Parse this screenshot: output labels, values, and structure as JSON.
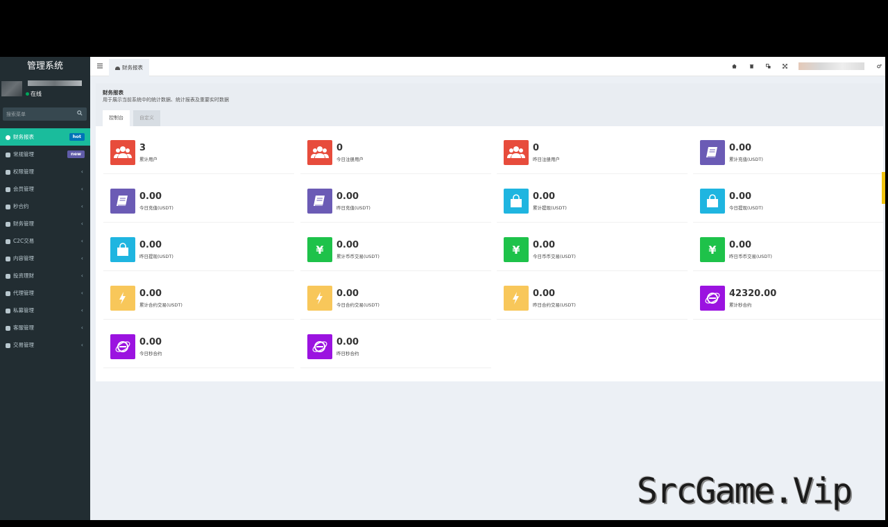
{
  "app": {
    "title": "管理系统"
  },
  "user": {
    "status": "在线"
  },
  "search": {
    "placeholder": "搜索菜单"
  },
  "sidebar": {
    "items": [
      {
        "label": "财务报表",
        "badge": "hot",
        "active": true,
        "icon": "dashboard-icon"
      },
      {
        "label": "常规管理",
        "badge": "new",
        "icon": "cogs-icon"
      },
      {
        "label": "权限管理",
        "icon": "group-icon"
      },
      {
        "label": "会员管理",
        "icon": "list-icon"
      },
      {
        "label": "秒合约",
        "icon": "calendar-icon"
      },
      {
        "label": "财务管理",
        "icon": "database-icon"
      },
      {
        "label": "C2C交易",
        "icon": "balance-icon"
      },
      {
        "label": "内容管理",
        "icon": "inbox-icon"
      },
      {
        "label": "投资理财",
        "icon": "circle-icon"
      },
      {
        "label": "代理管理",
        "icon": "briefcase-icon"
      },
      {
        "label": "私募管理",
        "icon": "diamond-icon"
      },
      {
        "label": "客服管理",
        "icon": "comment-icon"
      },
      {
        "label": "交易管理",
        "icon": "eye-icon"
      }
    ]
  },
  "header": {
    "tab": "财务报表"
  },
  "page": {
    "title": "财务报表",
    "description": "用于展示当前系统中的统计数据、统计报表及重要实时数据",
    "tabs": [
      "控制台",
      "自定义"
    ]
  },
  "stats": [
    {
      "value": "3",
      "label": "累计用户",
      "color": "#e74c3c",
      "icon": "users-icon"
    },
    {
      "value": "0",
      "label": "今日注册用户",
      "color": "#e74c3c",
      "icon": "users-icon"
    },
    {
      "value": "0",
      "label": "昨日注册用户",
      "color": "#e74c3c",
      "icon": "users-icon"
    },
    {
      "value": "0.00",
      "label": "累计充值(USDT)",
      "color": "#6b5bb5",
      "icon": "book-icon"
    },
    {
      "value": "0.00",
      "label": "今日充值(USDT)",
      "color": "#6b5bb5",
      "icon": "book-icon"
    },
    {
      "value": "0.00",
      "label": "昨日充值(USDT)",
      "color": "#6b5bb5",
      "icon": "book-icon"
    },
    {
      "value": "0.00",
      "label": "累计提现(USDT)",
      "color": "#1fb5e0",
      "icon": "shopping-bag-icon"
    },
    {
      "value": "0.00",
      "label": "今日提现(USDT)",
      "color": "#1fb5e0",
      "icon": "shopping-bag-icon"
    },
    {
      "value": "0.00",
      "label": "昨日提现(USDT)",
      "color": "#1fb5e0",
      "icon": "shopping-bag-icon"
    },
    {
      "value": "0.00",
      "label": "累计币币交易(USDT)",
      "color": "#1ec24a",
      "icon": "yen-icon"
    },
    {
      "value": "0.00",
      "label": "今日币币交易(USDT)",
      "color": "#1ec24a",
      "icon": "yen-icon"
    },
    {
      "value": "0.00",
      "label": "昨日币币交易(USDT)",
      "color": "#1ec24a",
      "icon": "yen-icon"
    },
    {
      "value": "0.00",
      "label": "累计合约交易(USDT)",
      "color": "#f8c75a",
      "icon": "bolt-icon"
    },
    {
      "value": "0.00",
      "label": "今日合约交易(USDT)",
      "color": "#f8c75a",
      "icon": "bolt-icon"
    },
    {
      "value": "0.00",
      "label": "昨日合约交易(USDT)",
      "color": "#f8c75a",
      "icon": "bolt-icon"
    },
    {
      "value": "42320.00",
      "label": "累计秒合约",
      "color": "#9b13e0",
      "icon": "internet-explorer-icon"
    },
    {
      "value": "0.00",
      "label": "今日秒合约",
      "color": "#9b13e0",
      "icon": "internet-explorer-icon"
    },
    {
      "value": "0.00",
      "label": "昨日秒合约",
      "color": "#9b13e0",
      "icon": "internet-explorer-icon"
    }
  ],
  "watermark": "SrcGame.Vip"
}
